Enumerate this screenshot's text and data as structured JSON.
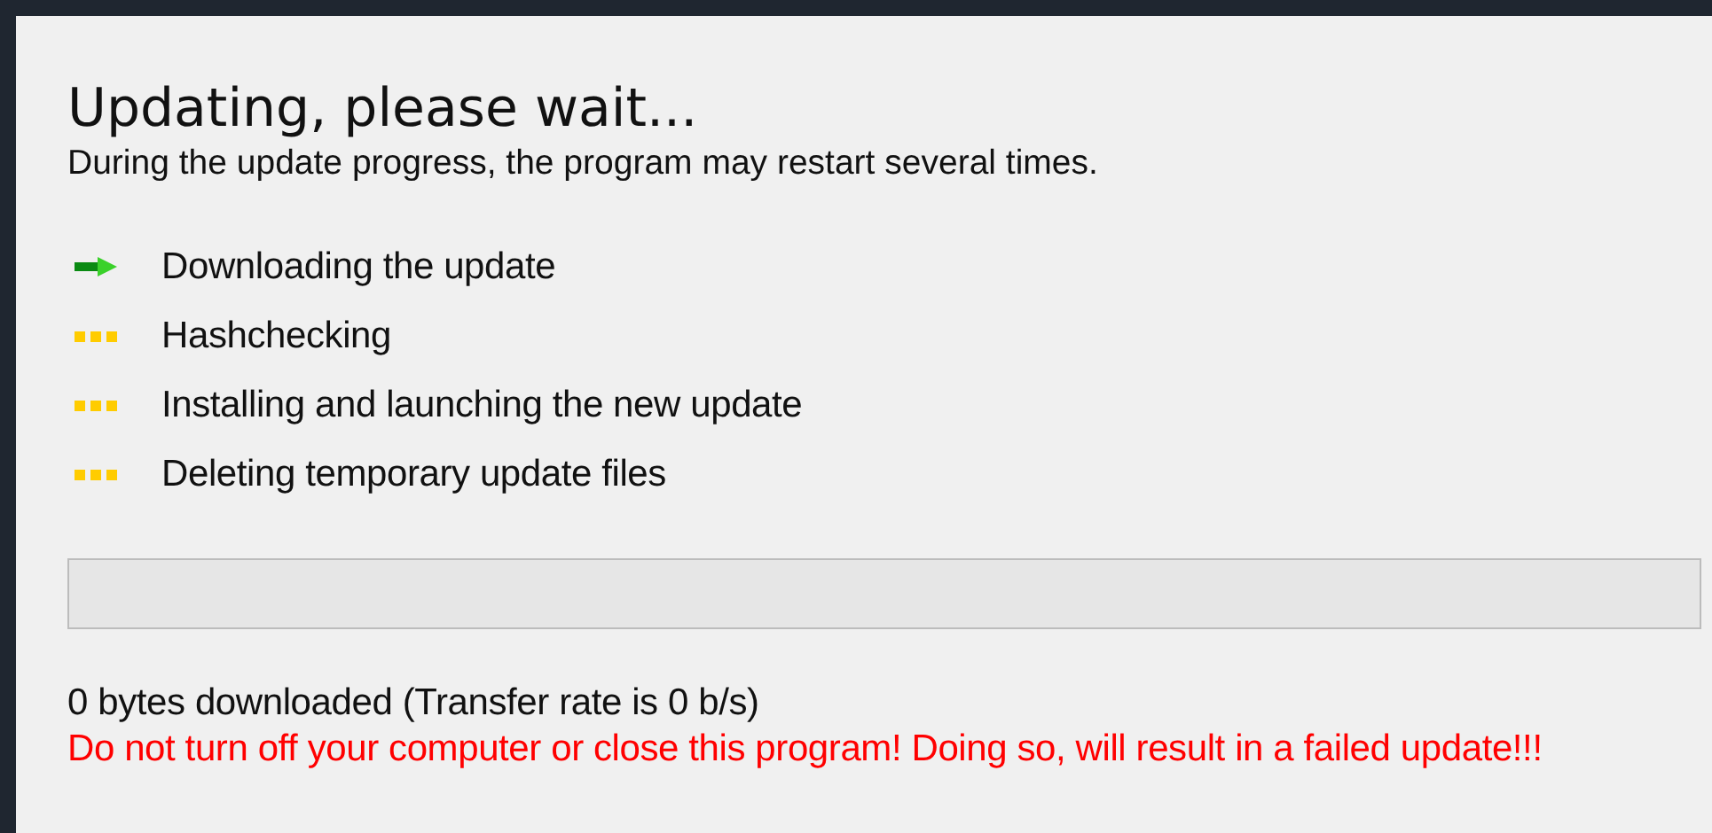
{
  "title": "Updating, please wait...",
  "subtitle": "During the update progress, the program may restart several times.",
  "steps": [
    {
      "label": "Downloading the update",
      "kind": "current"
    },
    {
      "label": "Hashchecking",
      "kind": "pending"
    },
    {
      "label": "Installing and launching the new update",
      "kind": "pending"
    },
    {
      "label": "Deleting temporary update files",
      "kind": "pending"
    }
  ],
  "progress": {
    "level": 0
  },
  "status": "0 bytes downloaded (Transfer rate is 0 b/s)",
  "warning": "Do not turn off your computer or close this program! Doing so, will result in a failed update!!!"
}
